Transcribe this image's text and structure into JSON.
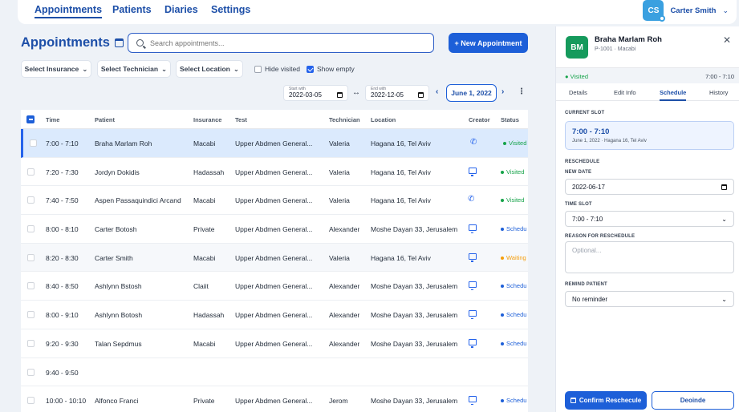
{
  "nav": {
    "tabs": [
      {
        "label": "Appointments"
      },
      {
        "label": "Patients"
      },
      {
        "label": "Diaries"
      },
      {
        "label": "Settings"
      }
    ],
    "user": {
      "initials": "CS",
      "name": "Carter Smith"
    }
  },
  "header": {
    "title": "Appointments",
    "search_placeholder": "Search appointments...",
    "new_button": "+ New Appointment"
  },
  "filters": {
    "insurance": "Select Insurance",
    "technician": "Select Technician",
    "location": "Select Location",
    "hide_visited": "Hide visited",
    "show_empty": "Show empty"
  },
  "dates": {
    "start_label": "Start with",
    "start_value": "2022-03-05",
    "end_label": "End with",
    "end_value": "2022-12-05",
    "current": "June 1, 2022"
  },
  "table": {
    "columns": [
      "Time",
      "Patient",
      "Insurance",
      "Test",
      "Technician",
      "Location",
      "Creator",
      "Status"
    ],
    "rows": [
      {
        "time": "7:00 - 7:10",
        "patient": "Braha Marlam Roh",
        "insurance": "Macabi",
        "test": "Upper Abdmen General...",
        "tech": "Valeria",
        "location": "Hagana 16, Tel Aviv",
        "creator": "phone",
        "status": "Visited"
      },
      {
        "time": "7:20 - 7:30",
        "patient": "Jordyn Dokidis",
        "insurance": "Hadassah",
        "test": "Upper Abdmen General...",
        "tech": "Valeria",
        "location": "Hagana 16, Tel Aviv",
        "creator": "monitor",
        "status": "Visited"
      },
      {
        "time": "7:40 - 7:50",
        "patient": "Aspen Passaquindici Arcand",
        "insurance": "Macabi",
        "test": "Upper Abdmen General...",
        "tech": "Valeria",
        "location": "Hagana 16, Tel Aviv",
        "creator": "phone",
        "status": "Visited"
      },
      {
        "time": "8:00 - 8:10",
        "patient": "Carter Botosh",
        "insurance": "Private",
        "test": "Upper Abdmen General...",
        "tech": "Alexander",
        "location": "Moshe Dayan 33, Jerusalem",
        "creator": "monitor",
        "status": "Schedu"
      },
      {
        "time": "8:20 - 8:30",
        "patient": "Carter Smith",
        "insurance": "Macabi",
        "test": "Upper Abdmen General...",
        "tech": "Valeria",
        "location": "Hagana 16, Tel Aviv",
        "creator": "monitor",
        "status": "Waiting"
      },
      {
        "time": "8:40 - 8:50",
        "patient": "Ashlynn Bstosh",
        "insurance": "Claiit",
        "test": "Upper Abdmen General...",
        "tech": "Alexander",
        "location": "Moshe Dayan 33, Jerusalem",
        "creator": "monitor",
        "status": "Schedu"
      },
      {
        "time": "8:00 - 9:10",
        "patient": "Ashlynn Botosh",
        "insurance": "Hadassah",
        "test": "Upper Abdmen General...",
        "tech": "Alexander",
        "location": "Moshe Dayan 33, Jerusalem",
        "creator": "monitor",
        "status": "Schedu"
      },
      {
        "time": "9:20 - 9:30",
        "patient": "Talan Sepdmus",
        "insurance": "Macabi",
        "test": "Upper Abdmen General...",
        "tech": "Alexander",
        "location": "Moshe Dayan 33, Jerusalem",
        "creator": "monitor",
        "status": "Schedu"
      },
      {
        "time": "9:40 - 9:50",
        "patient": "",
        "insurance": "",
        "test": "",
        "tech": "",
        "location": "",
        "creator": "",
        "status": ""
      },
      {
        "time": "10:00 - 10:10",
        "patient": "Alfonco Franci",
        "insurance": "Private",
        "test": "Upper Abdmen General...",
        "tech": "Jerom",
        "location": "Moshe Dayan 33, Jerusalem",
        "creator": "monitor",
        "status": "Schedu"
      }
    ]
  },
  "colors": {
    "visited": "#16a34a",
    "scheduled": "#1d5fd8",
    "waiting": "#f59e0b"
  },
  "panel": {
    "initials": "BM",
    "name": "Braha Marlam Roh",
    "sub": "P-1001 · Macabi",
    "status": "Visited",
    "time": "7:00 - 7:10",
    "tabs": [
      "Details",
      "Edit Info",
      "Schedule",
      "History"
    ],
    "current_slot_label": "CURRENT SLOT",
    "slot_time": "7:00 - 7:10",
    "slot_sub": "June 1, 2022 · Hagana 16, Tel Aviv",
    "reschedule_label": "RESCHEDULE",
    "new_date_label": "NEW DATE",
    "new_date": "2022-06-17",
    "time_slot_label": "TIME SLOT",
    "time_slot": "7:00 - 7:10",
    "reason_label": "REASON FOR RESCHEDULE",
    "reason_placeholder": "Optional...",
    "remind_label": "REMIND PATIENT",
    "remind_value": "No reminder",
    "confirm": "Confirm Reschecule",
    "decline": "Deoinde"
  }
}
